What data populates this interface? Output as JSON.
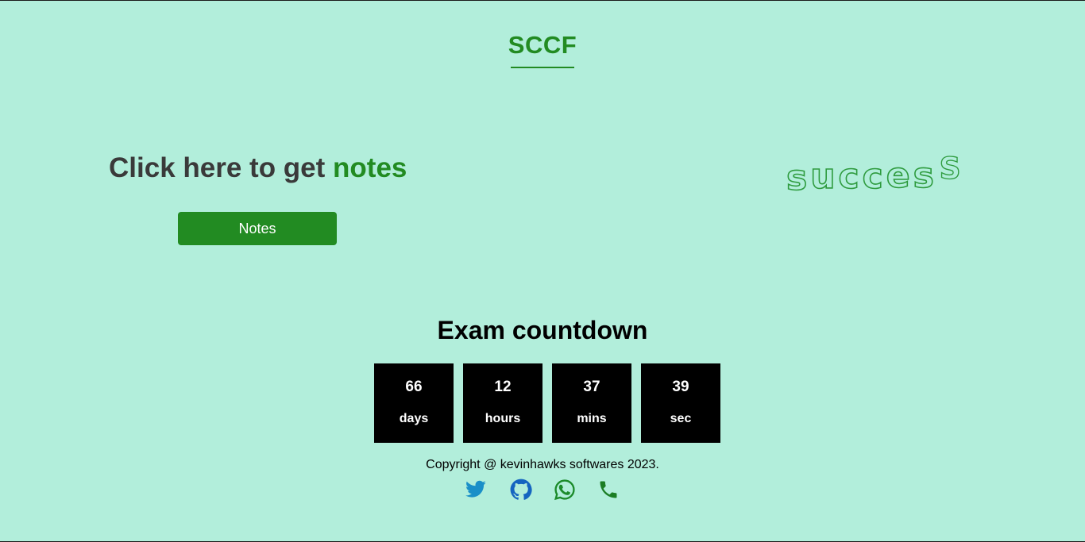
{
  "header": {
    "brand": "SCCF"
  },
  "hero": {
    "heading_prefix": "Click here to get ",
    "heading_accent": "notes",
    "button_label": "Notes"
  },
  "decor": {
    "letters": [
      "s",
      "u",
      "c",
      "c",
      "e",
      "s",
      "S"
    ]
  },
  "countdown": {
    "title": "Exam countdown",
    "items": [
      {
        "value": "66",
        "unit": "days"
      },
      {
        "value": "12",
        "unit": "hours"
      },
      {
        "value": "37",
        "unit": "mins"
      },
      {
        "value": "39",
        "unit": "sec"
      }
    ]
  },
  "footer": {
    "copyright": "Copyright @ kevinhawks softwares 2023.",
    "social": [
      {
        "icon": "twitter-icon",
        "color": "#1a8fc8"
      },
      {
        "icon": "github-icon",
        "color": "#1565c0"
      },
      {
        "icon": "whatsapp-icon",
        "color": "#1b8a2a"
      },
      {
        "icon": "phone-icon",
        "color": "#1b7d24"
      }
    ]
  },
  "colors": {
    "background": "#b2eedb",
    "accent": "#228b22",
    "heading": "#3a3a3a",
    "countdown_box": "#000000"
  }
}
